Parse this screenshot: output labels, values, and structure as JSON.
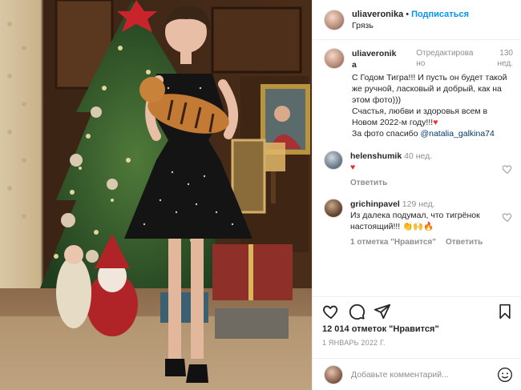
{
  "header": {
    "username": "uliaveronika",
    "separator": "•",
    "follow_label": "Подписаться",
    "location": "Грязь"
  },
  "caption": {
    "username": "uliaveronik",
    "username_wrap": "a",
    "edited": "Отредактирова но",
    "age": "130 нед.",
    "line1": "С Годом Тигра!!! И пусть он будет такой же ручной, ласковый и добрый, как на этом фото)))",
    "line2": "Счастья, любви и здоровья всем в Новом 2022-м году!!!",
    "line2_emoji": "♥",
    "line3_prefix": "За фото спасибо ",
    "line3_mention": "@natalia_galkina74"
  },
  "comments": [
    {
      "username": "helenshumik",
      "age": "40 нед.",
      "text": "♥",
      "reply_label": "Ответить"
    },
    {
      "username": "grichinpavel",
      "age": "129 нед.",
      "text": "Из далека подумал, что тигрёнок настоящий!!! 👏🙌🔥",
      "likes_label": "1 отметка \"Нравится\"",
      "reply_label": "Ответить"
    }
  ],
  "stats": {
    "likes": "12 014 отметок \"Нравится\"",
    "date": "1 ЯНВАРЬ 2022 Г."
  },
  "add_comment": {
    "placeholder": "Добавьте комментарий..."
  },
  "icons": {
    "like": "heart-icon",
    "comment": "comment-icon",
    "share": "share-icon",
    "save": "bookmark-icon",
    "emoji": "smiley-icon"
  },
  "colors": {
    "accent": "#0095f6",
    "text": "#262626",
    "muted": "#8e8e8e",
    "heart": "#ed2b3a"
  }
}
